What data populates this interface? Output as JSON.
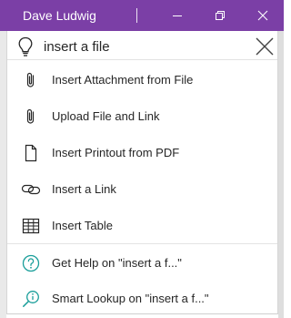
{
  "window": {
    "user_name": "Dave Ludwig",
    "controls": [
      "minimize",
      "restore",
      "close"
    ],
    "title_bar_color": "#7b3fa6"
  },
  "search": {
    "icon": "lightbulb-icon",
    "query": "insert a file",
    "clear_icon": "close-icon"
  },
  "results": [
    {
      "icon": "paperclip-icon",
      "label": "Insert Attachment from File"
    },
    {
      "icon": "paperclip-icon",
      "label": "Upload File and Link"
    },
    {
      "icon": "document-icon",
      "label": "Insert Printout from PDF"
    },
    {
      "icon": "link-icon",
      "label": "Insert a Link"
    },
    {
      "icon": "table-icon",
      "label": "Insert Table"
    }
  ],
  "help_items": [
    {
      "icon": "help-circle-icon",
      "label": "Get Help on \"insert a f...\""
    },
    {
      "icon": "smart-lookup-icon",
      "label": "Smart Lookup on \"insert a f...\""
    }
  ],
  "accent_color": "#1a9e9a"
}
